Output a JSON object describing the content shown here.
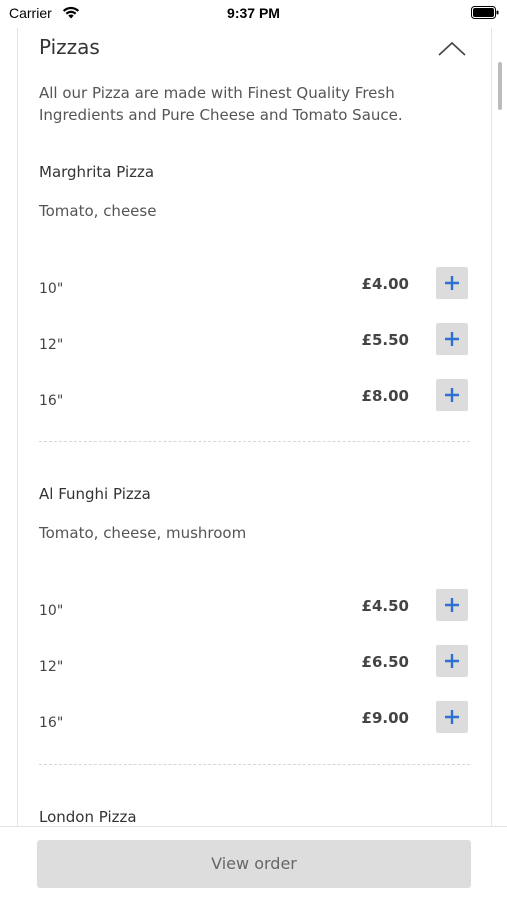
{
  "status_bar": {
    "carrier": "Carrier",
    "time": "9:37 PM"
  },
  "section": {
    "title": "Pizzas",
    "description": "All our Pizza are made with Finest Quality Fresh Ingredients and Pure Cheese and Tomato Sauce."
  },
  "items": [
    {
      "name": "Marghrita Pizza",
      "ingredients": "Tomato, cheese",
      "sizes": [
        {
          "size": "10\"",
          "price": "£4.00"
        },
        {
          "size": "12\"",
          "price": "£5.50"
        },
        {
          "size": "16\"",
          "price": "£8.00"
        }
      ]
    },
    {
      "name": "Al Funghi Pizza",
      "ingredients": "Tomato, cheese, mushroom",
      "sizes": [
        {
          "size": "10\"",
          "price": "£4.50"
        },
        {
          "size": "12\"",
          "price": "£6.50"
        },
        {
          "size": "16\"",
          "price": "£9.00"
        }
      ]
    },
    {
      "name": "London Pizza"
    }
  ],
  "footer": {
    "view_order_label": "View order"
  },
  "colors": {
    "accent": "#2f6fd0",
    "button_bg": "#dcdcdc"
  }
}
